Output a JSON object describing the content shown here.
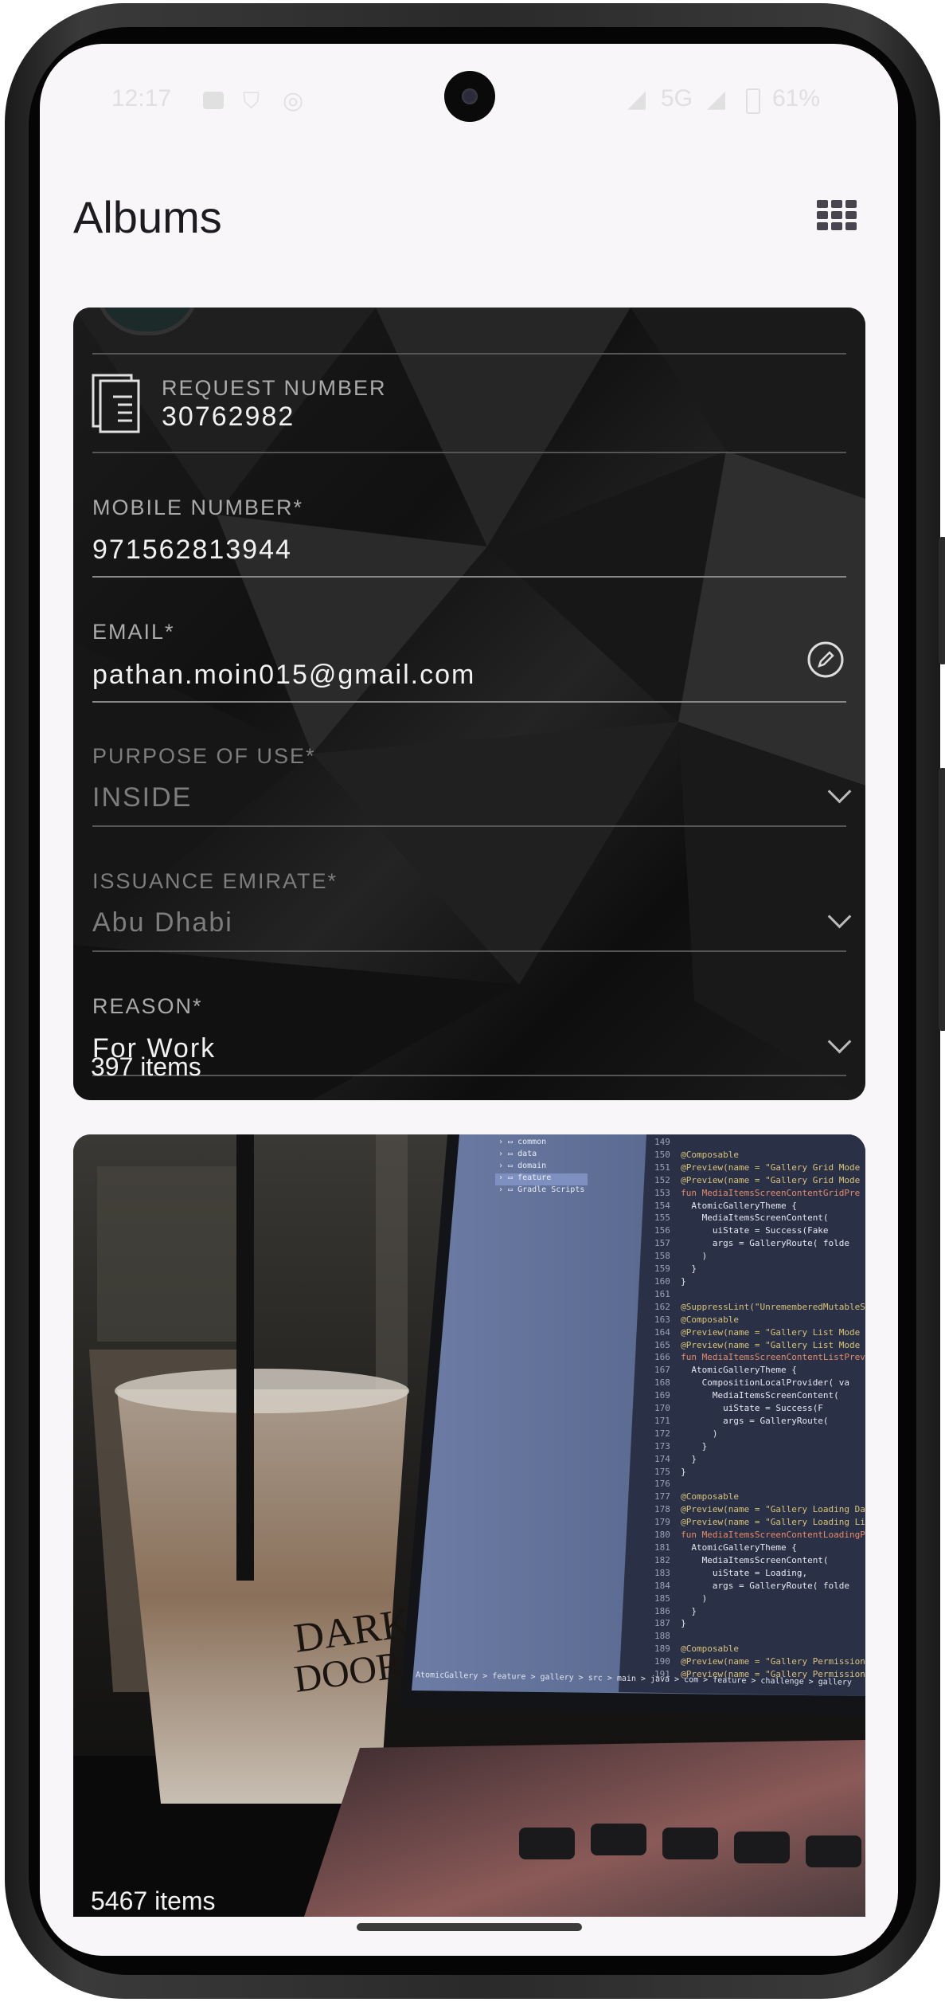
{
  "status_bar": {
    "time": "12:17",
    "network": "5G",
    "battery": "61%"
  },
  "header": {
    "title": "Albums",
    "layout_toggle_icon": "grid-view-icon"
  },
  "albums": [
    {
      "item_count": "397 items",
      "thumbnail_form": {
        "request_label": "REQUEST NUMBER",
        "request_value": "30762982",
        "mobile_label": "MOBILE NUMBER",
        "mobile_value": "971562813944",
        "email_label": "EMAIL",
        "email_value": "pathan.moin015@gmail.com",
        "purpose_label": "PURPOSE OF USE",
        "purpose_value": "INSIDE",
        "emirate_label": "ISSUANCE EMIRATE",
        "emirate_value": "Abu Dhabi",
        "reason_label": "REASON",
        "reason_value": "For Work",
        "required_mark": "*"
      }
    },
    {
      "item_count": "5467 items",
      "thumbnail_photo": {
        "cup_text": "DARK DOOR",
        "project_tree": [
          "common",
          "data",
          "domain",
          "feature",
          "Gradle Scripts"
        ],
        "code_lines": [
          {
            "n": "149",
            "t": ""
          },
          {
            "n": "150",
            "t": "@Composable"
          },
          {
            "n": "151",
            "t": "@Preview(name = \"Gallery Grid Mode"
          },
          {
            "n": "152",
            "t": "@Preview(name = \"Gallery Grid Mode"
          },
          {
            "n": "153",
            "t": "fun MediaItemsScreenContentGridPre"
          },
          {
            "n": "154",
            "t": "  AtomicGalleryTheme {"
          },
          {
            "n": "155",
            "t": "    MediaItemsScreenContent("
          },
          {
            "n": "156",
            "t": "      uiState = Success(Fake"
          },
          {
            "n": "157",
            "t": "      args = GalleryRoute( folde"
          },
          {
            "n": "158",
            "t": "    )"
          },
          {
            "n": "159",
            "t": "  }"
          },
          {
            "n": "160",
            "t": "}"
          },
          {
            "n": "161",
            "t": ""
          },
          {
            "n": "162",
            "t": "@SuppressLint(\"UnrememberedMutableS"
          },
          {
            "n": "163",
            "t": "@Composable"
          },
          {
            "n": "164",
            "t": "@Preview(name = \"Gallery List Mode"
          },
          {
            "n": "165",
            "t": "@Preview(name = \"Gallery List Mode"
          },
          {
            "n": "166",
            "t": "fun MediaItemsScreenContentListPrev"
          },
          {
            "n": "167",
            "t": "  AtomicGalleryTheme {"
          },
          {
            "n": "168",
            "t": "    CompositionLocalProvider( va"
          },
          {
            "n": "169",
            "t": "      MediaItemsScreenContent("
          },
          {
            "n": "170",
            "t": "        uiState = Success(F"
          },
          {
            "n": "171",
            "t": "        args = GalleryRoute("
          },
          {
            "n": "172",
            "t": "      )"
          },
          {
            "n": "173",
            "t": "    }"
          },
          {
            "n": "174",
            "t": "  }"
          },
          {
            "n": "175",
            "t": "}"
          },
          {
            "n": "176",
            "t": ""
          },
          {
            "n": "177",
            "t": "@Composable"
          },
          {
            "n": "178",
            "t": "@Preview(name = \"Gallery Loading Dar"
          },
          {
            "n": "179",
            "t": "@Preview(name = \"Gallery Loading Lig"
          },
          {
            "n": "180",
            "t": "fun MediaItemsScreenContentLoadingPr"
          },
          {
            "n": "181",
            "t": "  AtomicGalleryTheme {"
          },
          {
            "n": "182",
            "t": "    MediaItemsScreenContent("
          },
          {
            "n": "183",
            "t": "      uiState = Loading,"
          },
          {
            "n": "184",
            "t": "      args = GalleryRoute( folde"
          },
          {
            "n": "185",
            "t": "    )"
          },
          {
            "n": "186",
            "t": "  }"
          },
          {
            "n": "187",
            "t": "}"
          },
          {
            "n": "188",
            "t": ""
          },
          {
            "n": "189",
            "t": "@Composable"
          },
          {
            "n": "190",
            "t": "@Preview(name = \"Gallery Permission De"
          },
          {
            "n": "191",
            "t": "@Preview(name = \"Gallery Permission De"
          }
        ],
        "breadcrumb": "AtomicGallery > feature > gallery > src > main > java > com > feature > challenge > gallery"
      }
    }
  ],
  "colors": {
    "background": "#f8f6f8",
    "title": "#1c1b1f",
    "card_dark": "#141414"
  }
}
